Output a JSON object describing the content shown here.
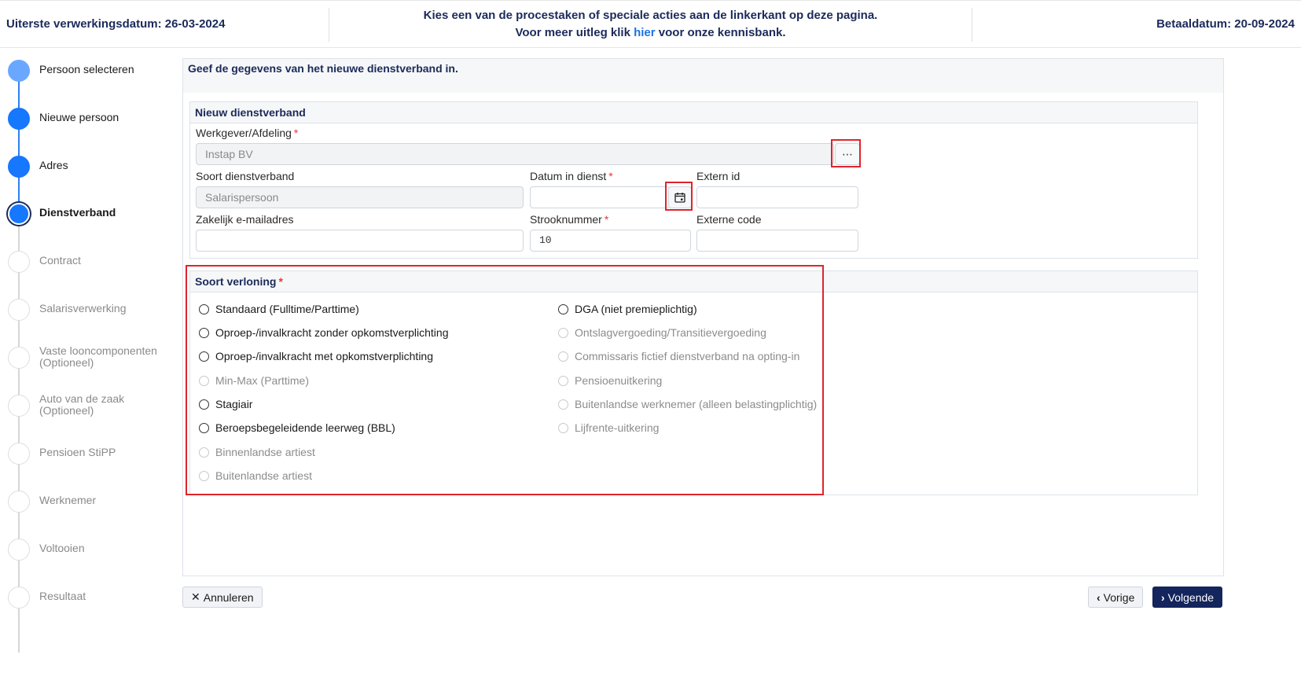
{
  "header": {
    "left_label": "Uiterste verwerkingsdatum: 26-03-2024",
    "center_line1": "Kies een van de procestaken of speciale acties aan de linkerkant op deze pagina.",
    "center_line2_pre": "Voor meer uitleg klik",
    "center_link": "hier",
    "center_line2_post": "voor onze kennisbank.",
    "right_label": "Betaaldatum: 20-09-2024"
  },
  "steps": [
    {
      "label": "Persoon selecteren",
      "state": "done"
    },
    {
      "label": "Nieuwe persoon",
      "state": "done"
    },
    {
      "label": "Adres",
      "state": "done"
    },
    {
      "label": "Dienstverband",
      "state": "active"
    },
    {
      "label": "Contract",
      "state": "todo"
    },
    {
      "label": "Salarisverwerking",
      "state": "todo"
    },
    {
      "label": "Vaste looncomponenten",
      "label2": "(Optioneel)",
      "state": "todo"
    },
    {
      "label": "Auto van de zaak",
      "label2": "(Optioneel)",
      "state": "todo"
    },
    {
      "label": "Pensioen StiPP",
      "state": "todo"
    },
    {
      "label": "Werknemer",
      "state": "todo"
    },
    {
      "label": "Voltooien",
      "state": "todo"
    },
    {
      "label": "Resultaat",
      "state": "todo"
    }
  ],
  "main": {
    "intro": "Geef de gegevens van het nieuwe dienstverband in."
  },
  "dienstverband": {
    "title": "Nieuw dienstverband",
    "werkgever_label": "Werkgever/Afdeling",
    "werkgever_value": "Instap BV",
    "browse_icon": "ellipsis-icon",
    "soort_label": "Soort dienstverband",
    "soort_value": "Salarispersoon",
    "datum_label": "Datum in dienst",
    "datum_value": "",
    "calendar_icon": "calendar-icon",
    "extern_id_label": "Extern id",
    "extern_id_value": "",
    "email_label": "Zakelijk e-mailadres",
    "email_value": "",
    "strook_label": "Strooknummer",
    "strook_value": "10",
    "extern_code_label": "Externe code",
    "extern_code_value": ""
  },
  "verloning": {
    "title": "Soort verloning",
    "left_options": [
      {
        "label": "Standaard (Fulltime/Parttime)",
        "enabled": true
      },
      {
        "label": "Oproep-/invalkracht zonder opkomstverplichting",
        "enabled": true
      },
      {
        "label": "Oproep-/invalkracht met opkomstverplichting",
        "enabled": true
      },
      {
        "label": "Min-Max (Parttime)",
        "enabled": false
      },
      {
        "label": "Stagiair",
        "enabled": true
      },
      {
        "label": "Beroepsbegeleidende leerweg (BBL)",
        "enabled": true
      },
      {
        "label": "Binnenlandse artiest",
        "enabled": false
      },
      {
        "label": "Buitenlandse artiest",
        "enabled": false
      }
    ],
    "right_options": [
      {
        "label": "DGA (niet premieplichtig)",
        "enabled": true
      },
      {
        "label": "Ontslagvergoeding/Transitievergoeding",
        "enabled": false
      },
      {
        "label": "Commissaris fictief dienstverband na opting-in",
        "enabled": false
      },
      {
        "label": "Pensioenuitkering",
        "enabled": false
      },
      {
        "label": "Buitenlandse werknemer (alleen belastingplichtig)",
        "enabled": false
      },
      {
        "label": "Lijfrente-uitkering",
        "enabled": false
      }
    ]
  },
  "footer": {
    "cancel_label": "Annuleren",
    "prev_label": "Vorige",
    "next_label": "Volgende"
  }
}
